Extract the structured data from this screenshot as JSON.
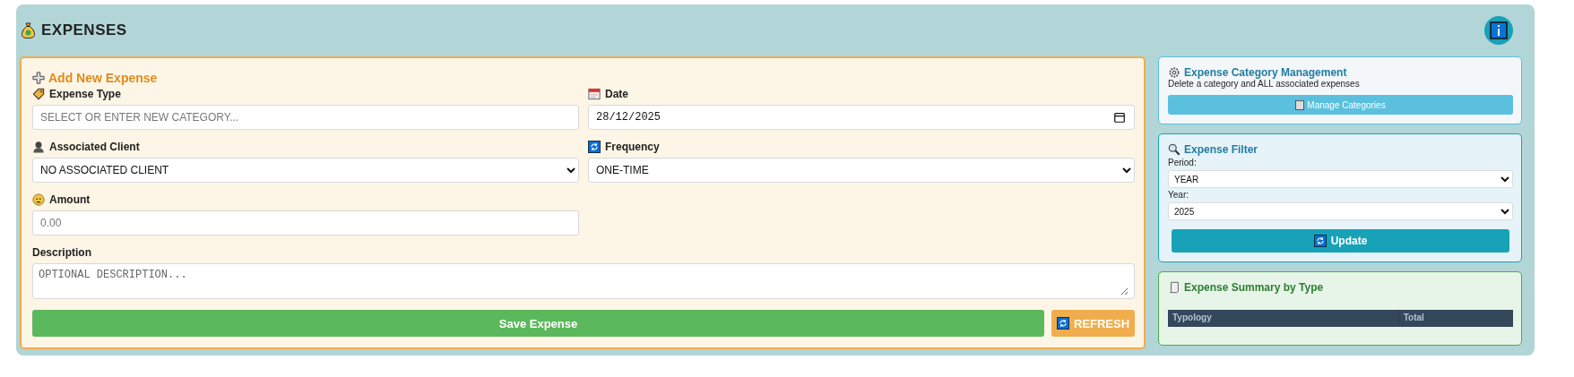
{
  "header": {
    "title": "EXPENSES"
  },
  "form": {
    "title": "Add New Expense",
    "fields": [
      {
        "kind": "text",
        "label": "Expense Type",
        "placeholder": "SELECT OR ENTER NEW CATEGORY..."
      },
      {
        "kind": "date",
        "label": "Date",
        "value": "28/12/2025"
      },
      {
        "kind": "select",
        "label": "Associated Client",
        "value": "NO ASSOCIATED CLIENT"
      },
      {
        "kind": "select",
        "label": "Frequency",
        "value": "ONE-TIME"
      },
      {
        "kind": "text",
        "label": "Amount",
        "placeholder": "0.00"
      },
      {
        "kind": "textarea",
        "label": "Description",
        "placeholder": "OPTIONAL DESCRIPTION..."
      }
    ],
    "save_button": "Save Expense",
    "refresh_button": "REFRESH"
  },
  "category_management": {
    "title": "Expense Category Management",
    "description": "Delete a category and ALL associated expenses",
    "button": "Manage Categories"
  },
  "filter": {
    "title": "Expense Filter",
    "fields": [
      {
        "label": "Period:",
        "value": "YEAR"
      },
      {
        "label": "Year:",
        "value": "2025"
      }
    ],
    "button": "Update"
  },
  "summary": {
    "title": "Expense Summary by Type",
    "columns": [
      "Typology",
      "Total"
    ]
  }
}
